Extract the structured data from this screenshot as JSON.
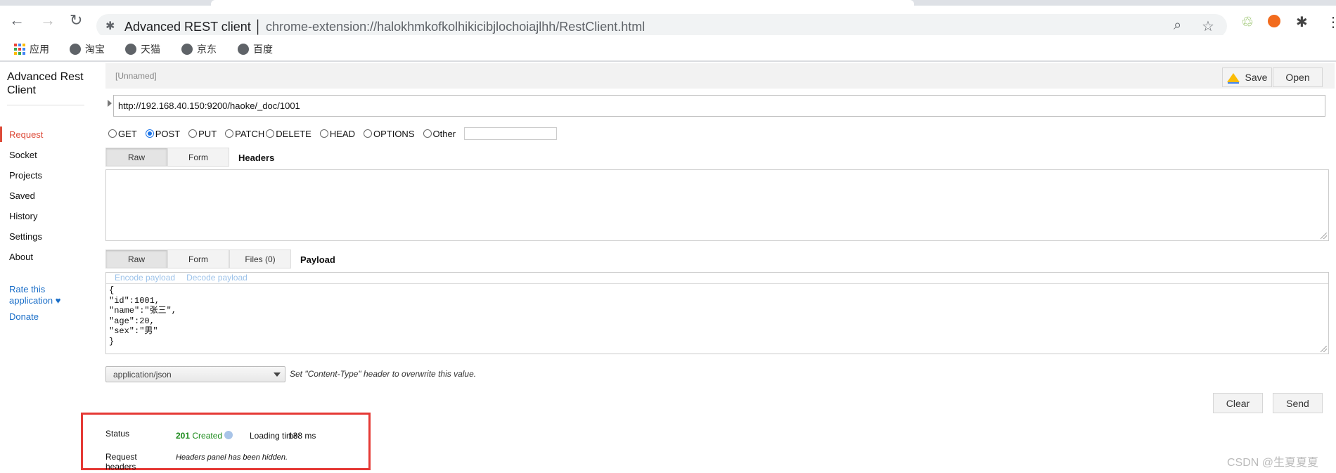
{
  "browser": {
    "title": "Advanced REST client",
    "url": "chrome-extension://halokhmkofkolhikicibjlochoiajlhh/RestClient.html",
    "bookmarks": [
      {
        "label": "应用",
        "icon": "apps-grid-icon"
      },
      {
        "label": "淘宝",
        "icon": "globe-icon"
      },
      {
        "label": "天猫",
        "icon": "globe-icon"
      },
      {
        "label": "京东",
        "icon": "globe-icon"
      },
      {
        "label": "百度",
        "icon": "globe-icon"
      }
    ]
  },
  "sidebar": {
    "title": "Advanced Rest Client",
    "items": [
      {
        "label": "Request",
        "active": true
      },
      {
        "label": "Socket"
      },
      {
        "label": "Projects"
      },
      {
        "label": "Saved"
      },
      {
        "label": "History"
      },
      {
        "label": "Settings"
      },
      {
        "label": "About"
      }
    ],
    "rate": "Rate this application ♥",
    "donate": "Donate",
    "accent": "#dd4b39"
  },
  "request": {
    "name": "[Unnamed]",
    "save": "Save",
    "open": "Open",
    "url": "http://192.168.40.150:9200/haoke/_doc/1001",
    "methods": [
      "GET",
      "POST",
      "PUT",
      "PATCH",
      "DELETE",
      "HEAD",
      "OPTIONS",
      "Other"
    ],
    "selected_method": "POST",
    "headers_tabs": [
      "Raw",
      "Form"
    ],
    "headers_label": "Headers",
    "payload_tabs": [
      "Raw",
      "Form",
      "Files (0)"
    ],
    "payload_label": "Payload",
    "encode": "Encode payload",
    "decode": "Decode payload",
    "payload": "{\n\"id\":1001,\n\"name\":\"张三\",\n\"age\":20,\n\"sex\":\"男\"\n}",
    "content_type": "application/json",
    "content_type_hint": "Set \"Content-Type\" header to overwrite this value.",
    "clear": "Clear",
    "send": "Send"
  },
  "response": {
    "status_label": "Status",
    "status_code": "201",
    "status_text": "Created",
    "status_color": "#1a8a1a",
    "loading_label": "Loading time:",
    "loading_value": "138 ms",
    "req_headers_label": "Request headers",
    "req_headers_note": "Headers panel has been hidden."
  },
  "watermark": "CSDN @生夏夏夏"
}
